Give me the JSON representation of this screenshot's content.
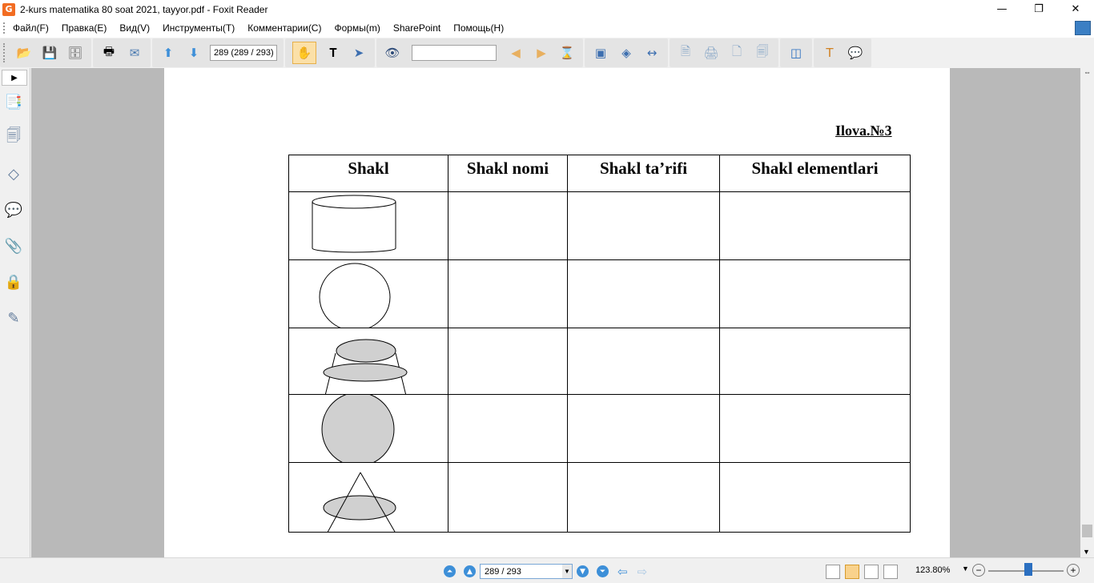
{
  "window": {
    "title": "2-kurs matematika 80 soat 2021, tayyor.pdf - Foxit Reader",
    "app_icon": "foxit-app-icon",
    "minimize": "—",
    "restore": "❐",
    "close": "✕"
  },
  "menu": {
    "items": [
      {
        "label": "Файл(F)"
      },
      {
        "label": "Правка(E)"
      },
      {
        "label": "Вид(V)"
      },
      {
        "label": "Инструменты(T)"
      },
      {
        "label": "Комментарии(C)"
      },
      {
        "label": "Формы(m)"
      },
      {
        "label": "SharePoint"
      },
      {
        "label": "Помощь(H)"
      }
    ]
  },
  "toolbar": {
    "page_field": "289 (289 / 293)",
    "search_value": ""
  },
  "document": {
    "ilova": "Ilova.№3",
    "headers": [
      "Shakl",
      "Shakl nomi",
      "Shakl ta’rifi",
      "Shakl elementlari"
    ],
    "rows": [
      {
        "shape": "cylinder"
      },
      {
        "shape": "circle"
      },
      {
        "shape": "truncated-cone"
      },
      {
        "shape": "sphere"
      },
      {
        "shape": "cone"
      }
    ]
  },
  "statusbar": {
    "page_field": "289 / 293",
    "zoom": "123.80%",
    "zoom_level_percent": 123.8
  }
}
